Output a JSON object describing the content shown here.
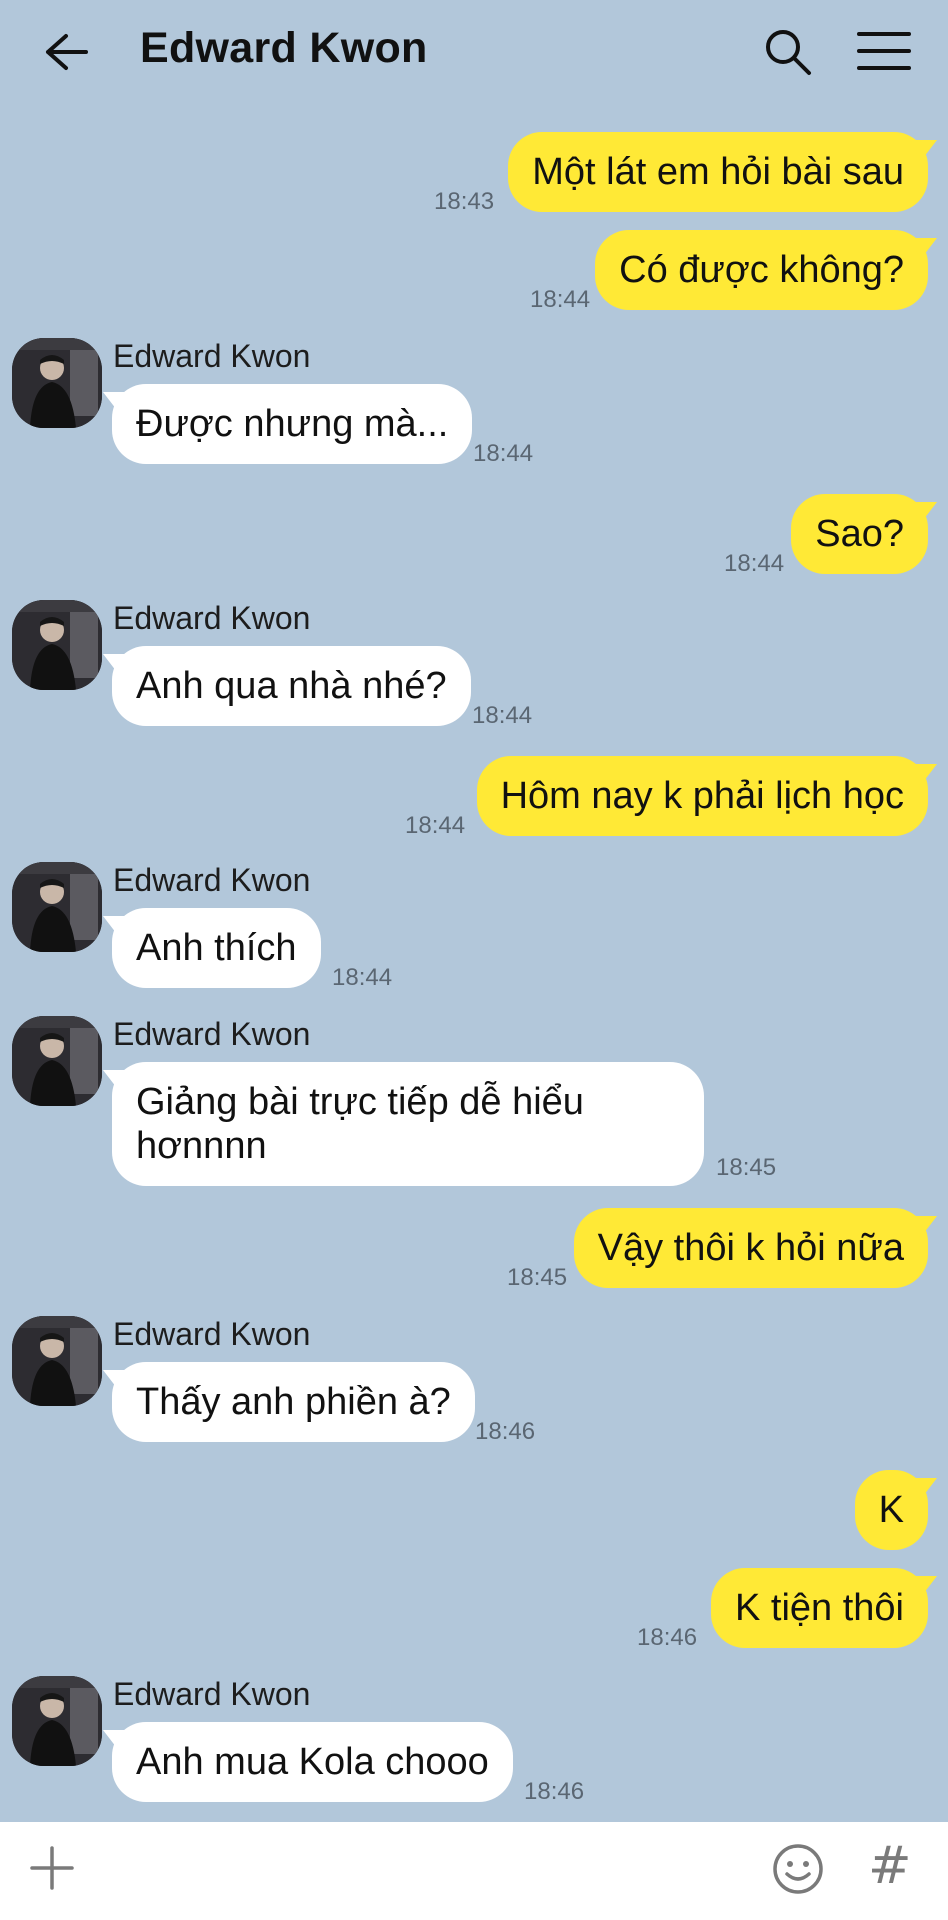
{
  "header": {
    "title": "Edward Kwon",
    "back_icon": "arrow-left-icon",
    "search_icon": "search-icon",
    "menu_icon": "hamburger-menu-icon"
  },
  "colors": {
    "background": "#b2c7da",
    "my_bubble": "#ffe936",
    "their_bubble": "#ffffff"
  },
  "messages": [
    {
      "from": "me",
      "text": "Một lát em hỏi bài sau",
      "time": "18:43"
    },
    {
      "from": "me",
      "text": "Có được không?",
      "time": "18:44"
    },
    {
      "from": "them",
      "sender": "Edward Kwon",
      "text": "Được nhưng mà...",
      "time": "18:44"
    },
    {
      "from": "me",
      "text": "Sao?",
      "time": "18:44"
    },
    {
      "from": "them",
      "sender": "Edward Kwon",
      "text": "Anh qua nhà nhé?",
      "time": "18:44"
    },
    {
      "from": "me",
      "text": "Hôm nay k phải lịch học",
      "time": "18:44"
    },
    {
      "from": "them",
      "sender": "Edward Kwon",
      "text": "Anh thích",
      "time": "18:44"
    },
    {
      "from": "them",
      "sender": "Edward Kwon",
      "text": "Giảng bài trực tiếp dễ hiểu hơnnnn",
      "time": "18:45"
    },
    {
      "from": "me",
      "text": "Vậy thôi k hỏi nữa",
      "time": "18:45"
    },
    {
      "from": "them",
      "sender": "Edward Kwon",
      "text": "Thấy anh phiền à?",
      "time": "18:46"
    },
    {
      "from": "me",
      "text": "K",
      "time": ""
    },
    {
      "from": "me",
      "text": "K tiện thôi",
      "time": "18:46"
    },
    {
      "from": "them",
      "sender": "Edward Kwon",
      "text": "Anh mua Kola chooo",
      "time": "18:46"
    }
  ],
  "input_bar": {
    "plus_icon": "plus-icon",
    "emoji_icon": "emoji-icon",
    "hash_label": "#"
  }
}
